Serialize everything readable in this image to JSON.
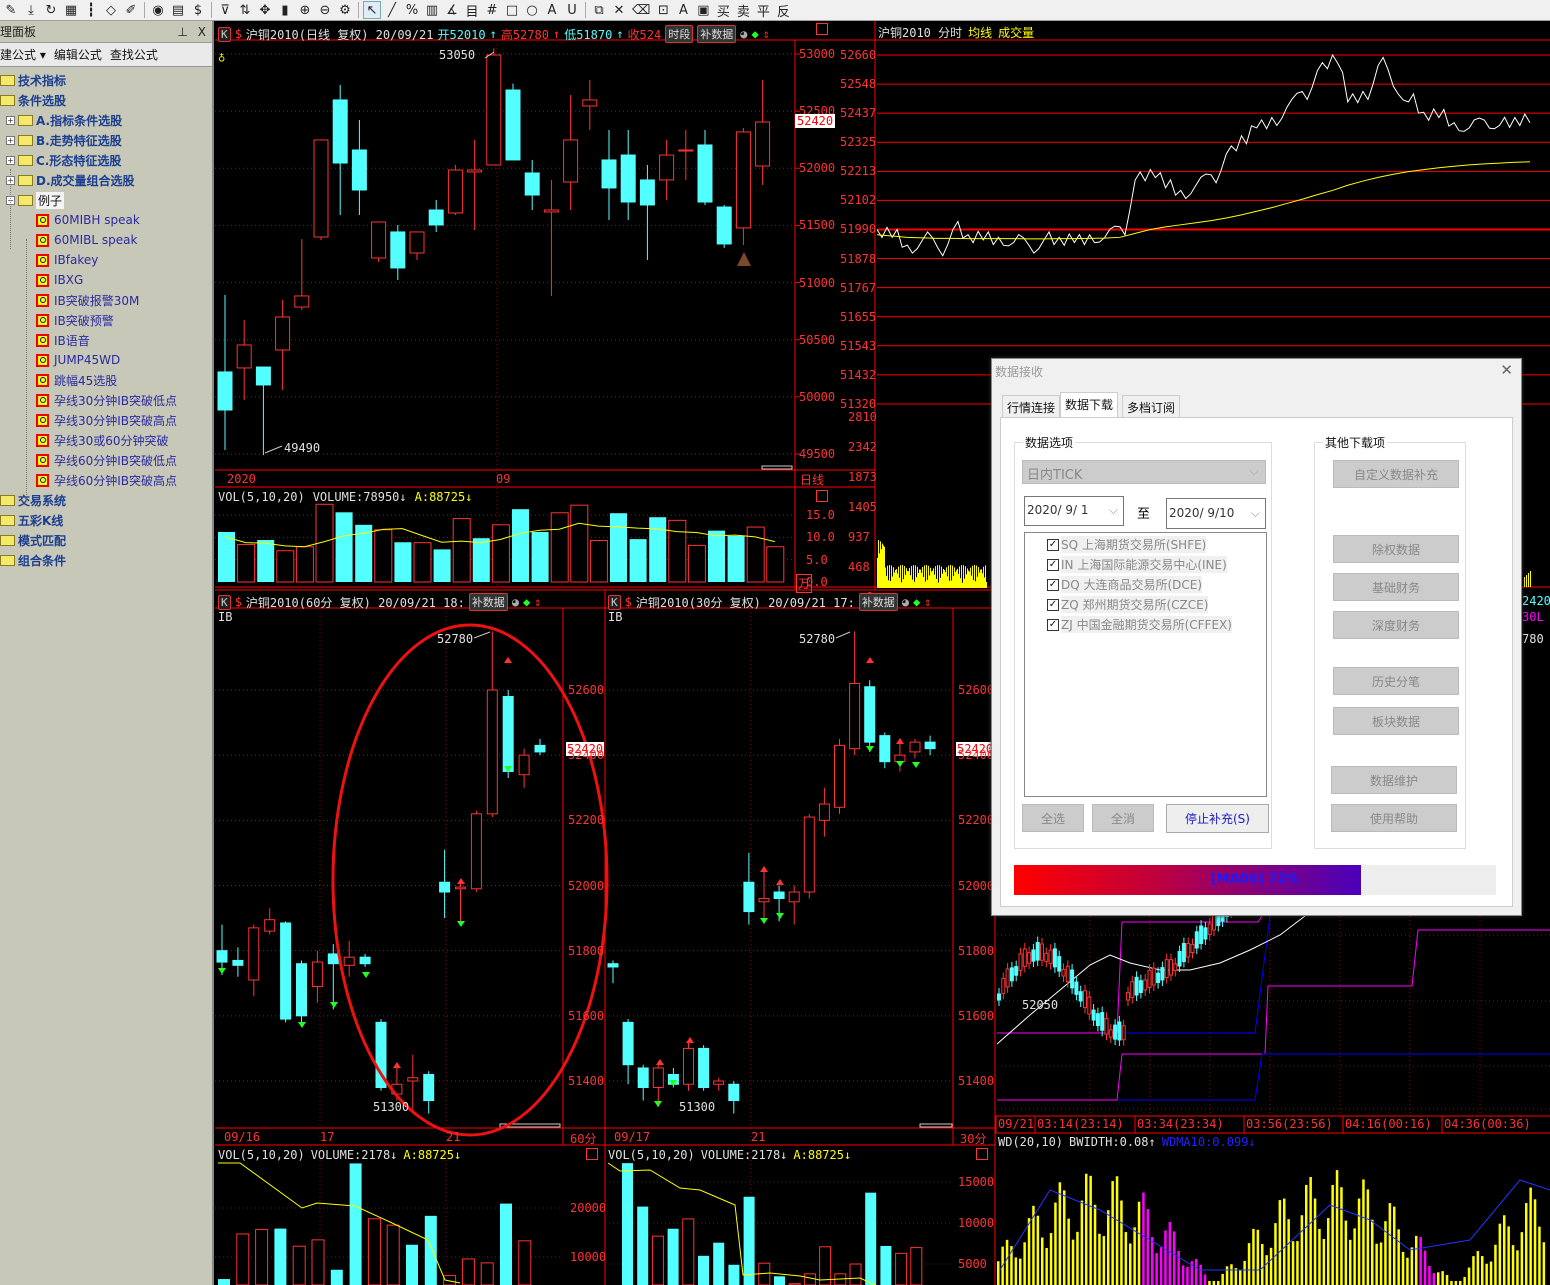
{
  "toolbar": {
    "icons": [
      "pen-icon",
      "download-icon",
      "refresh-icon",
      "grid-icon",
      "bars-icon",
      "diamond-icon",
      "edit-icon",
      "play-icon",
      "doc-icon",
      "dollar-icon",
      "filter-icon",
      "sort-icon",
      "move-icon",
      "column-icon",
      "zoom-in-icon",
      "zoom-out-icon",
      "gear-icon",
      "pointer-icon",
      "line-icon",
      "percent-icon",
      "channel-icon",
      "angle-icon",
      "fib-icon",
      "hash-icon",
      "rect-icon",
      "circle-icon",
      "text-icon",
      "magnet-icon",
      "copy-icon",
      "delete-icon",
      "trash-icon",
      "lock-icon",
      "color-icon",
      "save-icon"
    ],
    "glyphs": [
      "✎",
      "⤓",
      "↻",
      "▦",
      "┇",
      "◇",
      "✐",
      "◉",
      "▤",
      "$",
      "⊽",
      "⇅",
      "✥",
      "▮",
      "⊕",
      "⊖",
      "⚙",
      "↖",
      "╱",
      "%",
      "▥",
      "∡",
      "目",
      "#",
      "□",
      "○",
      "A",
      "U",
      "⧉",
      "✕",
      "⌫",
      "⊡",
      "A",
      "▣"
    ],
    "trade_buttons": [
      "买",
      "卖",
      "平",
      "反"
    ]
  },
  "left_panel": {
    "title": "理面板",
    "pin": "ᵖ",
    "close": "X",
    "tools": [
      "建公式 ▾",
      "编辑公式",
      "查找公式"
    ],
    "tree": [
      {
        "label": "技术指标",
        "level": 0,
        "type": "folder"
      },
      {
        "label": "条件选股",
        "level": 0,
        "type": "folder"
      },
      {
        "label": "A.指标条件选股",
        "level": 1,
        "type": "folder"
      },
      {
        "label": "B.走势特征选股",
        "level": 1,
        "type": "folder"
      },
      {
        "label": "C.形态特征选股",
        "level": 1,
        "type": "folder"
      },
      {
        "label": "D.成交量组合选股",
        "level": 1,
        "type": "folder"
      },
      {
        "label": "例子",
        "level": 1,
        "type": "open"
      },
      {
        "label": "60MIBH  speak",
        "level": 2,
        "type": "leaf"
      },
      {
        "label": "60MIBL speak",
        "level": 2,
        "type": "leaf"
      },
      {
        "label": "IBfakey",
        "level": 2,
        "type": "leaf"
      },
      {
        "label": "IBXG",
        "level": 2,
        "type": "leaf"
      },
      {
        "label": "IB突破报警30M",
        "level": 2,
        "type": "leaf"
      },
      {
        "label": "IB突破预警",
        "level": 2,
        "type": "leaf"
      },
      {
        "label": "IB语音",
        "level": 2,
        "type": "leaf"
      },
      {
        "label": "JUMP45WD",
        "level": 2,
        "type": "leaf"
      },
      {
        "label": "跳幅45选股",
        "level": 2,
        "type": "leaf"
      },
      {
        "label": "孕线30分钟IB突破低点",
        "level": 2,
        "type": "leaf"
      },
      {
        "label": "孕线30分钟IB突破高点",
        "level": 2,
        "type": "leaf"
      },
      {
        "label": "孕线30或60分钟突破",
        "level": 2,
        "type": "leaf"
      },
      {
        "label": "孕线60分钟IB突破低点",
        "level": 2,
        "type": "leaf"
      },
      {
        "label": "孕线60分钟IB突破高点",
        "level": 2,
        "type": "leaf"
      },
      {
        "label": "交易系统",
        "level": 0,
        "type": "folder"
      },
      {
        "label": "五彩K线",
        "level": 0,
        "type": "folder"
      },
      {
        "label": "模式匹配",
        "level": 0,
        "type": "folder"
      },
      {
        "label": "组合条件",
        "level": 0,
        "type": "folder"
      }
    ]
  },
  "daily": {
    "k_btn": "K",
    "title": "沪铜2010(日线 复权) 20/09/21",
    "open": "开52010",
    "high": "高52780",
    "low": "低51870",
    "close": "收524",
    "btn_period": "时段",
    "btn_fill": "补数据",
    "hi_label": "53050",
    "lo_label": "49490",
    "price_ticks": [
      "53000",
      "52500",
      "52000",
      "51500",
      "51000",
      "50500",
      "50000",
      "49500"
    ],
    "price_tick_values": [
      53000,
      52500,
      52000,
      51500,
      51000,
      50500,
      50000,
      49500
    ],
    "current_price": "52420",
    "date_labels": [
      "2020",
      "09"
    ],
    "period_label": "日线",
    "candles": [
      [
        50218,
        50891,
        49535,
        49885
      ],
      [
        50253,
        50673,
        49973,
        50454
      ],
      [
        50261,
        50261,
        49490,
        50104
      ],
      [
        50410,
        50848,
        50060,
        50699
      ],
      [
        50786,
        51380,
        50760,
        50883
      ],
      [
        51399,
        52248,
        51373,
        52248
      ],
      [
        52598,
        52729,
        51591,
        52046
      ],
      [
        52160,
        52423,
        51591,
        51810
      ],
      [
        51215,
        51530,
        51180,
        51530
      ],
      [
        51443,
        51504,
        51023,
        51128
      ],
      [
        51259,
        51443,
        51198,
        51443
      ],
      [
        51635,
        51723,
        51443,
        51504
      ],
      [
        51609,
        52029,
        51591,
        51985
      ],
      [
        51968,
        52248,
        51460,
        51985
      ],
      [
        52029,
        53050,
        52029,
        52991
      ],
      [
        52685,
        52741,
        52073,
        52073
      ],
      [
        51959,
        52073,
        51635,
        51766
      ],
      [
        51618,
        51898,
        50883,
        51635
      ],
      [
        51880,
        52641,
        51635,
        52248
      ],
      [
        52545,
        52772,
        52335,
        52598
      ],
      [
        52073,
        52335,
        51548,
        51828
      ],
      [
        52116,
        52335,
        51548,
        51705
      ],
      [
        51898,
        52029,
        51198,
        51679
      ],
      [
        51898,
        52248,
        51723,
        52116
      ],
      [
        52151,
        52335,
        51898,
        52160
      ],
      [
        52204,
        52335,
        51679,
        51705
      ],
      [
        51661,
        51679,
        51303,
        51338
      ],
      [
        51478,
        52353,
        51329,
        52318
      ],
      [
        52020,
        52772,
        51854,
        52405
      ]
    ],
    "vol_header": {
      "name": "VOL(5,10,20)",
      "volume": "VOLUME:78950↓",
      "a": "A:88725↓"
    },
    "vol_ticks": [
      "15.0",
      "10.0",
      "5.0",
      "0.0"
    ],
    "vol_unit": "万",
    "volumes": [
      11.2,
      8.4,
      9.4,
      7.0,
      7.9,
      17.4,
      15.6,
      12.8,
      11.7,
      8.9,
      8.8,
      7.3,
      14.2,
      9.8,
      12.8,
      16.3,
      11.2,
      15.5,
      17.2,
      9.3,
      15.4,
      9.6,
      14.5,
      13.8,
      8.2,
      11.5,
      10.3,
      12.3,
      7.9
    ],
    "vol_up": [
      false,
      true,
      false,
      true,
      true,
      true,
      false,
      false,
      true,
      false,
      true,
      false,
      true,
      false,
      true,
      false,
      false,
      true,
      true,
      true,
      false,
      false,
      false,
      true,
      true,
      false,
      false,
      true,
      true
    ]
  },
  "intraday": {
    "title": "沪铜2010 分时",
    "avg_label": "均线",
    "vol_label": "成交量",
    "price_ticks": [
      "52660",
      "52548",
      "52437",
      "52325",
      "52213",
      "52102",
      "51990",
      "51878",
      "51767",
      "51655",
      "51543",
      "51432",
      "51320"
    ],
    "vol_ticks": [
      "2810",
      "2342",
      "1873",
      "1405",
      "937",
      "468",
      "0"
    ],
    "prices": [
      51990,
      51960,
      51930,
      51950,
      51920,
      51990,
      51970,
      51950,
      51960,
      51940,
      51930,
      51950,
      51960,
      51940,
      51970,
      51960,
      52000,
      52180,
      52220,
      52150,
      52140,
      52160,
      52200,
      52280,
      52350,
      52380,
      52420,
      52460,
      52520,
      52600,
      52660,
      52480,
      52520,
      52620,
      52540,
      52480,
      52440,
      52420,
      52400,
      52380,
      52410,
      52390,
      52420,
      52400
    ],
    "avg": [
      51970,
      51965,
      51960,
      51958,
      51956,
      51956,
      51955,
      51955,
      51955,
      51955,
      51954,
      51954,
      51955,
      51955,
      51956,
      51957,
      51960,
      51975,
      51990,
      52000,
      52008,
      52016,
      52024,
      52034,
      52046,
      52060,
      52074,
      52090,
      52106,
      52124,
      52140,
      52160,
      52176,
      52190,
      52202,
      52212,
      52220,
      52227,
      52233,
      52238,
      52242,
      52245,
      52248,
      52250
    ],
    "side_labels": [
      "2420",
      "30L",
      "780"
    ]
  },
  "min60": {
    "k_btn": "K",
    "title": "沪铜2010(60分 复权) 20/09/21 18:",
    "btn_fill": "补数据",
    "indicator": "IB",
    "hi_label": "52780",
    "lo_label": "51300",
    "price_ticks": [
      "52600",
      "52400",
      "52200",
      "52000",
      "51800",
      "51600",
      "51400"
    ],
    "price_tick_values": [
      52600,
      52400,
      52200,
      52000,
      51800,
      51600,
      51400
    ],
    "current_price": "52420",
    "date_labels": [
      "09/16",
      "17",
      "21"
    ],
    "period_label": "60分",
    "candles": [
      [
        51800,
        51880,
        51725,
        51765
      ],
      [
        51770,
        51810,
        51720,
        51755
      ],
      [
        51710,
        51880,
        51660,
        51870
      ],
      [
        51860,
        51930,
        51850,
        51895
      ],
      [
        51885,
        51890,
        51580,
        51590
      ],
      [
        51760,
        51770,
        51570,
        51600
      ],
      [
        51690,
        51800,
        51640,
        51765
      ],
      [
        51790,
        51820,
        51620,
        51760
      ],
      [
        51755,
        51830,
        51720,
        51780
      ],
      [
        51780,
        51790,
        51750,
        51760
      ],
      [
        51580,
        51590,
        51370,
        51380
      ],
      [
        51360,
        51440,
        51340,
        51390
      ],
      [
        51400,
        51480,
        51300,
        51410
      ],
      [
        51420,
        51430,
        51300,
        51340
      ],
      [
        52010,
        52110,
        51900,
        51980
      ],
      [
        51990,
        52010,
        51890,
        51995
      ],
      [
        51990,
        52230,
        51980,
        52220
      ],
      [
        52220,
        52780,
        52210,
        52600
      ],
      [
        52580,
        52600,
        52330,
        52350
      ],
      [
        52340,
        52420,
        52300,
        52400
      ],
      [
        52430,
        52450,
        52400,
        52410
      ]
    ],
    "vol_header": {
      "name": "VOL(5,10,20)",
      "volume": "VOLUME:2178↓",
      "a": "A:88725↓"
    },
    "vol_ticks": [
      "20000",
      "10000"
    ],
    "vol_tick_values": [
      20000,
      10000
    ],
    "volumes": [
      5500,
      14700,
      15600,
      15800,
      12200,
      13500,
      7400,
      29100,
      17800,
      16500,
      12500,
      18400,
      6200,
      9600,
      8800,
      20900,
      13300
    ],
    "vol_up": [
      false,
      true,
      true,
      false,
      true,
      true,
      false,
      false,
      true,
      true,
      false,
      false,
      true,
      true,
      true,
      false,
      true
    ]
  },
  "min30": {
    "k_btn": "K",
    "title": "沪铜2010(30分 复权) 20/09/21 17:",
    "btn_fill": "补数据",
    "indicator": "IB",
    "hi_label": "52780",
    "lo_label": "51300",
    "price_ticks": [
      "52600",
      "52400",
      "52200",
      "52000",
      "51800",
      "51600",
      "51400"
    ],
    "price_tick_values": [
      52600,
      52400,
      52200,
      52000,
      51800,
      51600,
      51400
    ],
    "current_price": "52420",
    "date_labels": [
      "09/17",
      "21"
    ],
    "period_label": "30分",
    "candles": [
      [
        51760,
        51770,
        51700,
        51750
      ],
      [
        51580,
        51590,
        51390,
        51450
      ],
      [
        51440,
        51450,
        51340,
        51380
      ],
      [
        51380,
        51460,
        51320,
        51440
      ],
      [
        51420,
        51440,
        51380,
        51390
      ],
      [
        51390,
        51520,
        51370,
        51500
      ],
      [
        51500,
        51510,
        51370,
        51380
      ],
      [
        51390,
        51410,
        51370,
        51400
      ],
      [
        51390,
        51400,
        51300,
        51340
      ],
      [
        52010,
        52100,
        51880,
        51920
      ],
      [
        51950,
        52050,
        51890,
        51960
      ],
      [
        51980,
        52000,
        51890,
        51960
      ],
      [
        51950,
        52000,
        51880,
        51980
      ],
      [
        51980,
        52220,
        51960,
        52210
      ],
      [
        52200,
        52300,
        52150,
        52250
      ],
      [
        52240,
        52450,
        52220,
        52430
      ],
      [
        52420,
        52780,
        52400,
        52620
      ],
      [
        52610,
        52630,
        52410,
        52440
      ],
      [
        52460,
        52470,
        52360,
        52380
      ],
      [
        52380,
        52440,
        52350,
        52400
      ],
      [
        52410,
        52450,
        52390,
        52440
      ],
      [
        52440,
        52460,
        52400,
        52420
      ]
    ],
    "vol_header": {
      "name": "VOL(5,10,20)",
      "volume": "VOLUME:2178↓",
      "a": "A:88725↓"
    },
    "vol_ticks": [
      "15000",
      "10000",
      "5000"
    ],
    "vol_tick_values": [
      15000,
      10000,
      5000
    ],
    "volumes": [
      17300,
      12000,
      8400,
      9300,
      10500,
      6000,
      7600,
      4900,
      13200,
      5100,
      3500,
      2600,
      3800,
      7100,
      3800,
      5000,
      13700,
      7200,
      6300,
      7000
    ],
    "vol_up": [
      false,
      false,
      true,
      false,
      true,
      false,
      false,
      false,
      false,
      true,
      false,
      true,
      true,
      true,
      true,
      true,
      false,
      false,
      true,
      true
    ]
  },
  "tick_panel": {
    "low_label": "52050",
    "time_labels": [
      "09/21",
      "03:14(23:14)",
      "03:34(23:34)",
      "03:56(23:56)",
      "04:16(00:16)",
      "04:36(00:36)"
    ],
    "wd_header": {
      "name": "WD(20,10)",
      "bwidth": "BWIDTH:0.08↑",
      "wdma": "WDMA10:0.099↓"
    }
  },
  "dialog": {
    "title": "数据接收",
    "close": "✕",
    "tabs": [
      "行情连接",
      "数据下载",
      "多档订阅"
    ],
    "active_tab": 1,
    "data_group_title": "数据选项",
    "data_type": "日内TICK",
    "date_from": "2020/  9/  1",
    "date_to_label": "至",
    "date_to": "2020/  9/10",
    "exchanges": [
      {
        "label": "SQ 上海期货交易所(SHFE)",
        "checked": true
      },
      {
        "label": "IN 上海国际能源交易中心(INE)",
        "checked": true
      },
      {
        "label": "DQ 大连商品交易所(DCE)",
        "checked": true
      },
      {
        "label": "ZQ 郑州期货交易所(CZCE)",
        "checked": true
      },
      {
        "label": "ZJ 中国金融期货交易所(CFFEX)",
        "checked": true
      }
    ],
    "select_all": "全选",
    "deselect_all": "全消",
    "stop_fill": "停止补充(S)",
    "other_group_title": "其他下载项",
    "other_buttons": [
      "自定义数据补充",
      "除权数据",
      "基础财务",
      "深度财务",
      "历史分笔",
      "板块数据",
      "数据维护",
      "使用帮助"
    ],
    "progress_text": "[MA06] 72%",
    "progress": 0.72
  },
  "colors": {
    "up": "#ff3232",
    "down": "#54ffff",
    "grid": "#ff0000",
    "ma": "#ffff00",
    "magenta": "#ff00ff",
    "blue": "#0000ff"
  }
}
